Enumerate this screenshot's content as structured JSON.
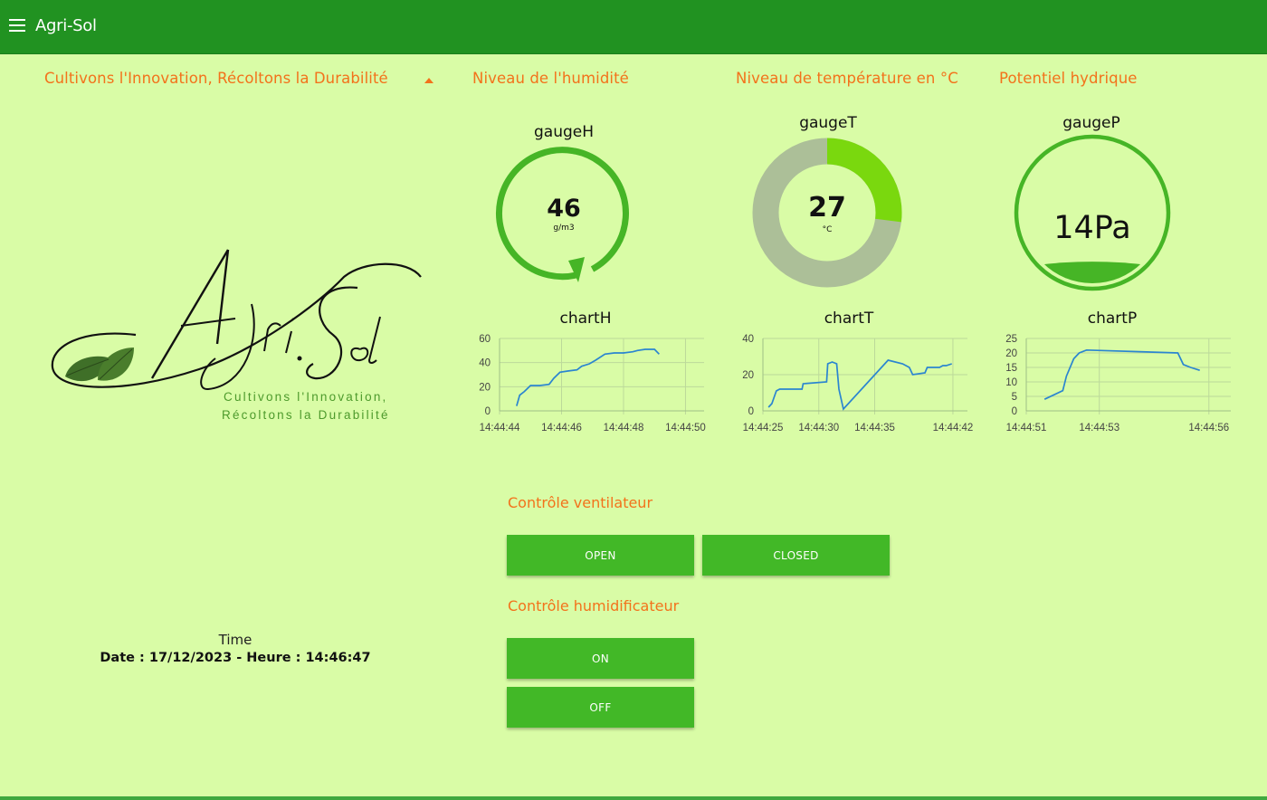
{
  "app": {
    "title": "Agri-Sol"
  },
  "groups": {
    "brand": "Cultivons l'Innovation, Récoltons la Durabilité",
    "humidity": "Niveau de l'humidité",
    "temperature": "Niveau de température en °C",
    "water": "Potentiel hydrique"
  },
  "logo": {
    "text": "Agri.Sol",
    "tagline1": "Cultivons l'Innovation,",
    "tagline2": "Récoltons la Durabilité"
  },
  "gauges": {
    "humidity": {
      "label": "gaugeH",
      "value": "46",
      "unit": "g/m3"
    },
    "temperature": {
      "label": "gaugeT",
      "value": "27",
      "unit": "°C",
      "fill_fraction": 0.27
    },
    "water": {
      "label": "gaugeP",
      "value": "14Pa",
      "level_fraction": 0.14
    }
  },
  "colors": {
    "topbar": "#219221",
    "background": "#d9fca6",
    "accent": "#f3721b",
    "gauge_green": "#46b526",
    "gauge_lime": "#7ad80e",
    "gauge_track": "#acbf98",
    "line": "#2b85d0",
    "button": "#42b827"
  },
  "chart_data": [
    {
      "type": "line",
      "title": "chartH",
      "ylim": [
        0,
        60
      ],
      "yticks": [
        "0",
        "20",
        "40",
        "60"
      ],
      "xticks": [
        {
          "t": 0,
          "label": "14:44:44"
        },
        {
          "t": 2,
          "label": "14:44:46"
        },
        {
          "t": 4,
          "label": "14:44:48"
        },
        {
          "t": 6,
          "label": "14:44:50"
        }
      ],
      "xlim": [
        0,
        6.6
      ],
      "series": [
        {
          "x": [
            0.55,
            0.65,
            0.8,
            1.0,
            1.3,
            1.6,
            1.75,
            1.95,
            2.2,
            2.5,
            2.65,
            2.9,
            3.1,
            3.4,
            3.7,
            4.0,
            4.3,
            4.45,
            4.7,
            5.0,
            5.15
          ],
          "y": [
            4,
            13,
            16,
            21,
            21,
            22,
            27,
            32,
            33,
            34,
            37,
            39,
            42,
            47,
            48,
            48,
            49,
            50,
            51,
            51,
            47
          ]
        }
      ],
      "grid": true
    },
    {
      "type": "line",
      "title": "chartT",
      "ylim": [
        0,
        40
      ],
      "yticks": [
        "0",
        "20",
        "40"
      ],
      "xticks": [
        {
          "t": 0,
          "label": "14:44:25"
        },
        {
          "t": 5,
          "label": "14:44:30"
        },
        {
          "t": 10,
          "label": "14:44:35"
        },
        {
          "t": 17,
          "label": "14:44:42"
        }
      ],
      "xlim": [
        0,
        18.3
      ],
      "series": [
        {
          "x": [
            0.5,
            0.8,
            1.2,
            1.5,
            2.0,
            3.5,
            3.6,
            5.7,
            5.8,
            6.2,
            6.6,
            6.8,
            7.2,
            11.2,
            12.5,
            13.1,
            13.4,
            14.5,
            14.7,
            15.8,
            16.1,
            16.4,
            16.9
          ],
          "y": [
            2,
            4,
            11,
            12,
            12,
            12,
            15,
            16,
            26,
            27,
            26,
            12,
            1,
            28,
            26,
            24,
            20,
            21,
            24,
            24,
            25,
            25,
            26
          ]
        }
      ],
      "grid": true
    },
    {
      "type": "line",
      "title": "chartP",
      "ylim": [
        0,
        25
      ],
      "yticks": [
        "0",
        "5",
        "10",
        "15",
        "20",
        "25"
      ],
      "xticks": [
        {
          "t": 0,
          "label": "14:44:51"
        },
        {
          "t": 2,
          "label": "14:44:53"
        },
        {
          "t": 5,
          "label": "14:44:56"
        }
      ],
      "xlim": [
        0,
        5.6
      ],
      "series": [
        {
          "x": [
            0.5,
            1.0,
            1.1,
            1.3,
            1.45,
            1.65,
            4.15,
            4.3,
            4.5,
            4.75
          ],
          "y": [
            4,
            7,
            12,
            18,
            20,
            21,
            20,
            16,
            15,
            14
          ]
        }
      ],
      "grid": true
    }
  ],
  "controls": {
    "fan": {
      "title": "Contrôle ventilateur",
      "open": "OPEN",
      "closed": "CLOSED"
    },
    "humidifier": {
      "title": "Contrôle humidificateur",
      "on": "ON",
      "off": "OFF"
    }
  },
  "time": {
    "label": "Time",
    "value": "Date : 17/12/2023 - Heure : 14:46:47"
  }
}
